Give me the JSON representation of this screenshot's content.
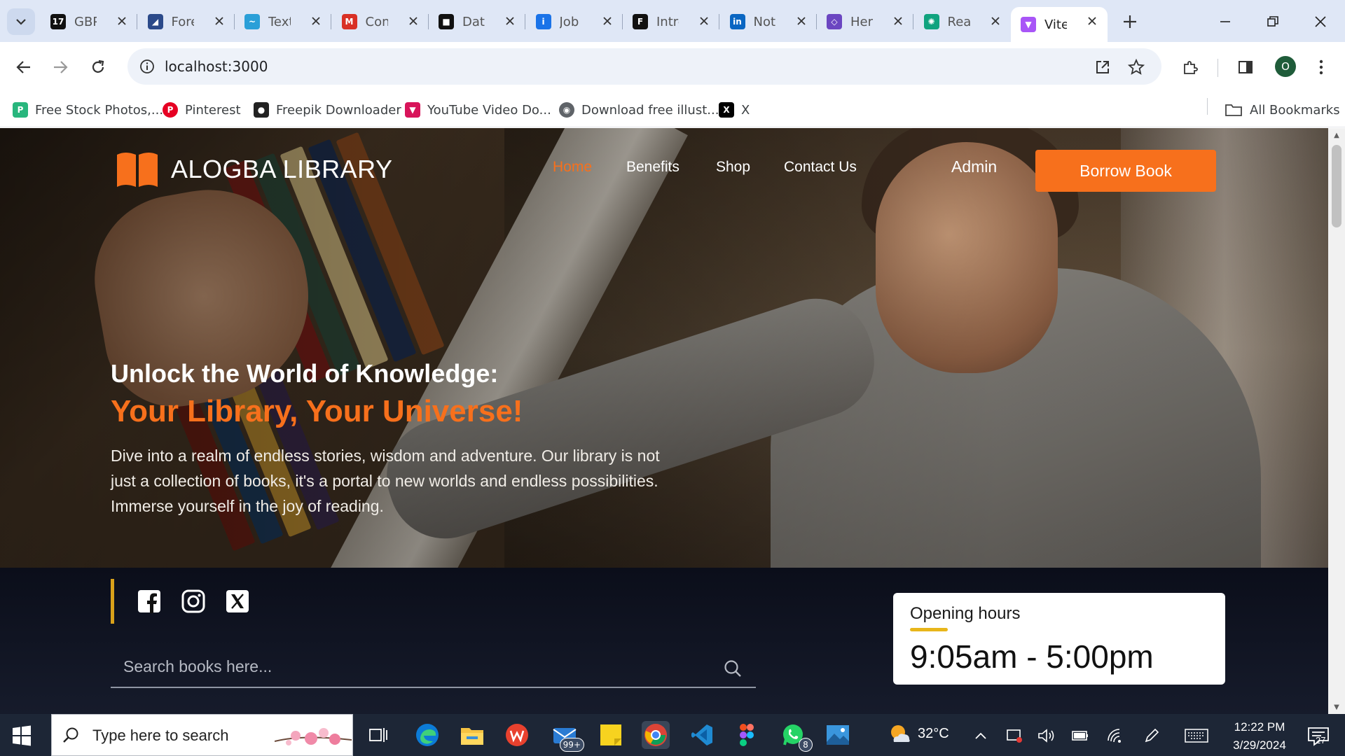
{
  "browser": {
    "tabs": [
      {
        "label": "GBP",
        "icon": "gbp-icon",
        "color": "#111111"
      },
      {
        "label": "Fore",
        "icon": "forecast-icon",
        "color": "#2b4a8a"
      },
      {
        "label": "Text",
        "icon": "textbird-icon",
        "color": "#2a9fd8"
      },
      {
        "label": "Con",
        "icon": "gmail-icon",
        "color": "#d93025"
      },
      {
        "label": "Data",
        "icon": "squares-icon",
        "color": "#111111"
      },
      {
        "label": "Job",
        "icon": "info-icon",
        "color": "#1a73e8"
      },
      {
        "label": "Intro",
        "icon": "framer-icon",
        "color": "#111111"
      },
      {
        "label": "Noti",
        "icon": "linkedin-icon",
        "color": "#0a66c2"
      },
      {
        "label": "Hero",
        "icon": "shield-icon",
        "color": "#6b46c1"
      },
      {
        "label": "Rea",
        "icon": "openai-icon",
        "color": "#10a37f"
      },
      {
        "label": "Vite",
        "icon": "vite-icon",
        "color": "#a855f7",
        "active": true
      }
    ],
    "url": "localhost:3000",
    "profile_initial": "O",
    "bookmarks": [
      {
        "label": "Free Stock Photos,...",
        "icon": "freestock-icon",
        "color": "#28b67d"
      },
      {
        "label": "Pinterest",
        "icon": "pinterest-icon",
        "color": "#e60023"
      },
      {
        "label": "Freepik Downloader",
        "icon": "freepik-icon",
        "color": "#222222"
      },
      {
        "label": "YouTube Video Do...",
        "icon": "youtube-download-icon",
        "color": "#d8145a"
      },
      {
        "label": "Download free illust...",
        "icon": "globe-icon",
        "color": "#5f6368"
      },
      {
        "label": "X",
        "icon": "x-logo-icon",
        "color": "#000000"
      }
    ],
    "all_bookmarks": "All Bookmarks"
  },
  "site": {
    "logo_text": "ALOGBA LIBRARY",
    "nav": [
      "Home",
      "Benefits",
      "Shop",
      "Contact Us"
    ],
    "active_nav": "Home",
    "admin": "Admin",
    "cta": "Borrow Book",
    "hero_line1": "Unlock the World of Knowledge:",
    "hero_line2": "Your Library, Your Universe!",
    "hero_desc": "Dive into a realm of endless stories, wisdom and adventure. Our library is not just a collection of books, it's a portal to new worlds and endless possibilities. Immerse yourself in the joy of reading.",
    "search_placeholder": "Search books here...",
    "hours_title": "Opening hours",
    "hours_time": "9:05am - 5:00pm",
    "accent_color": "#f7701c"
  },
  "taskbar": {
    "search_placeholder": "Type here to search",
    "mail_badge": "99+",
    "whatsapp_badge": "8",
    "temperature": "32°C",
    "time": "12:22 PM",
    "date": "3/29/2024",
    "notification_count": "27"
  }
}
